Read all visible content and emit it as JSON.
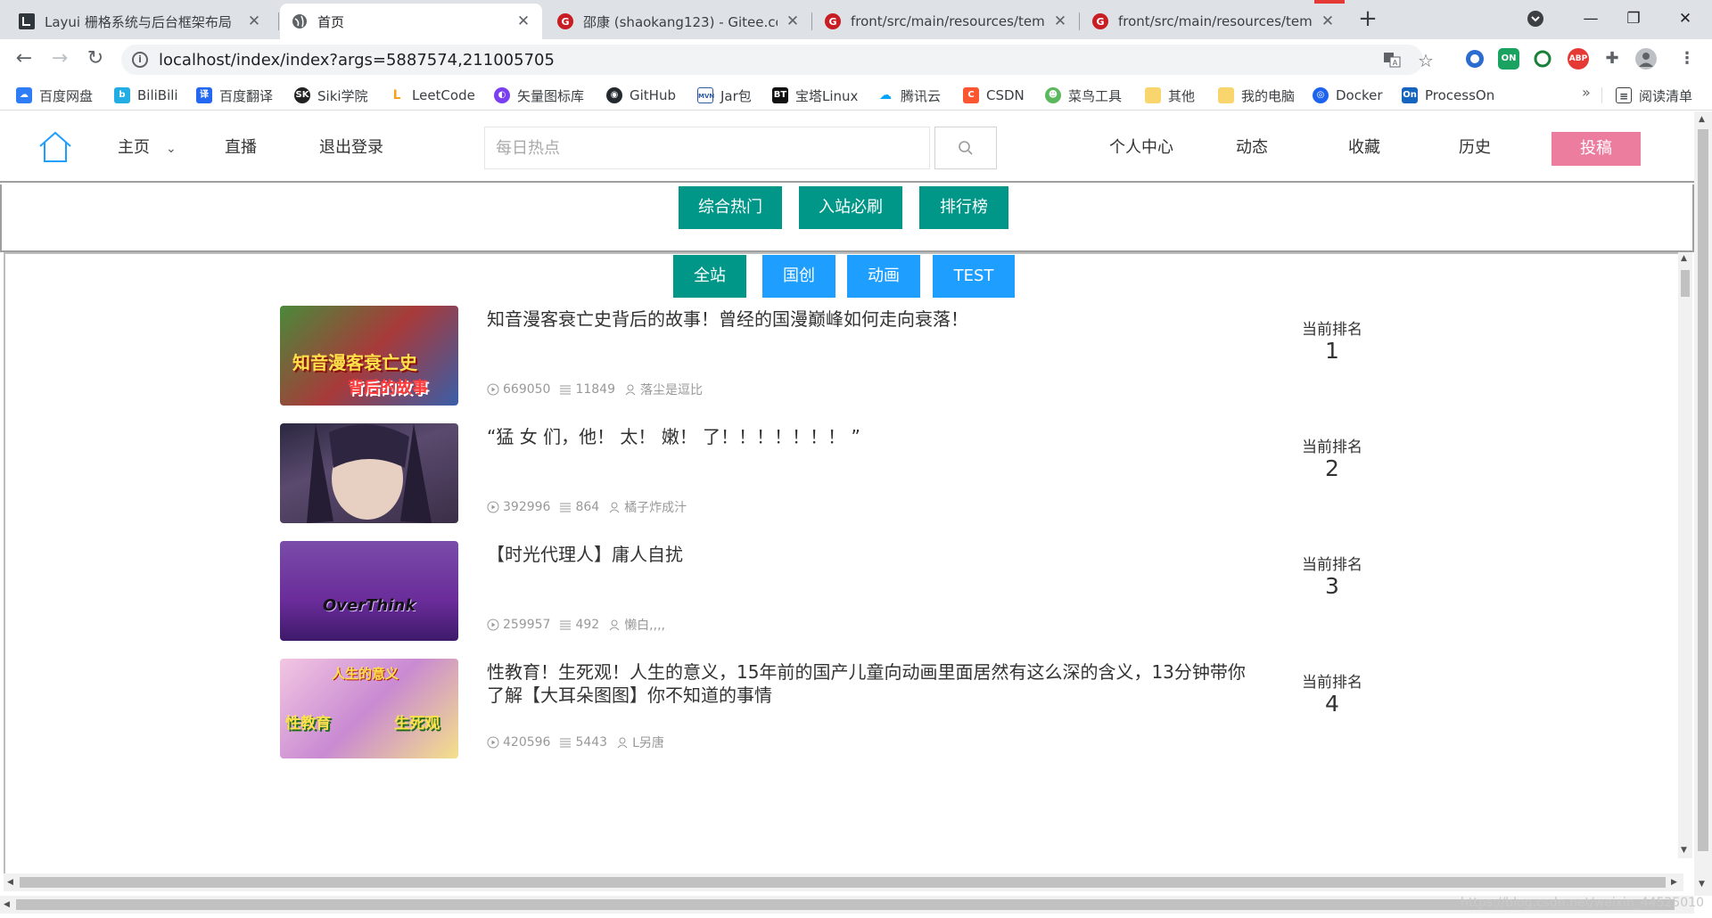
{
  "browser": {
    "tabs": [
      {
        "title": "Layui 栅格系统与后台框架布局",
        "icon": "layui-icon"
      },
      {
        "title": "首页",
        "icon": "globe-icon"
      },
      {
        "title": "邵康 (shaokang123) - Gitee.com",
        "icon": "gitee-icon"
      },
      {
        "title": "front/src/main/resources/templates",
        "icon": "gitee-icon"
      },
      {
        "title": "front/src/main/resources/templates",
        "icon": "gitee-icon"
      }
    ],
    "url": "localhost/index/index?args=5887574,211005705",
    "bookmarks": [
      "百度网盘",
      "BiliBili",
      "百度翻译",
      "Siki学院",
      "LeetCode",
      "矢量图标库",
      "GitHub",
      "Jar包",
      "宝塔Linux",
      "腾讯云",
      "CSDN",
      "菜鸟工具",
      "其他",
      "我的电脑",
      "Docker",
      "ProcessOn"
    ],
    "reading_list": "阅读清单",
    "more": "»"
  },
  "header": {
    "nav_home": "主页",
    "nav_live": "直播",
    "nav_logout": "退出登录",
    "search_placeholder": "每日热点",
    "nav_profile": "个人中心",
    "nav_dynamic": "动态",
    "nav_favorites": "收藏",
    "nav_history": "历史",
    "post_button": "投稿"
  },
  "top_tabs": [
    "综合热门",
    "入站必刷",
    "排行榜"
  ],
  "category_tabs": [
    "全站",
    "国创",
    "动画",
    "TEST"
  ],
  "colors": {
    "teal": "#009688",
    "blue": "#1e9fff",
    "pink": "#ec7d9f"
  },
  "videos": [
    {
      "title": "知音漫客衰亡史背后的故事！曾经的国漫巅峰如何走向衰落！",
      "plays": "669050",
      "danmaku": "11849",
      "author": "落尘是逗比",
      "rank_label": "当前排名",
      "rank": "1",
      "thumb_text_1": "知音漫客衰亡史",
      "thumb_text_2": "背后的故事"
    },
    {
      "title": "“猛 女 们，他！ 太！ 嫩！ 了！！！！！！！ ”",
      "plays": "392996",
      "danmaku": "864",
      "author": "橘子炸成汁",
      "rank_label": "当前排名",
      "rank": "2"
    },
    {
      "title": "【时光代理人】庸人自扰",
      "plays": "259957",
      "danmaku": "492",
      "author": "懒白,,,,",
      "rank_label": "当前排名",
      "rank": "3",
      "thumb_text_1": "OverThink"
    },
    {
      "title": "性教育！生死观！人生的意义，15年前的国产儿童向动画里面居然有这么深的含义，13分钟带你了解【大耳朵图图】你不知道的事情",
      "plays": "420596",
      "danmaku": "5443",
      "author": "L另唐",
      "rank_label": "当前排名",
      "rank": "4",
      "thumb_text_1": "人生的意义",
      "thumb_text_2": "性教育",
      "thumb_text_3": "生死观"
    }
  ],
  "watermark": "https://blog.csdn.net/weixin_44525010"
}
